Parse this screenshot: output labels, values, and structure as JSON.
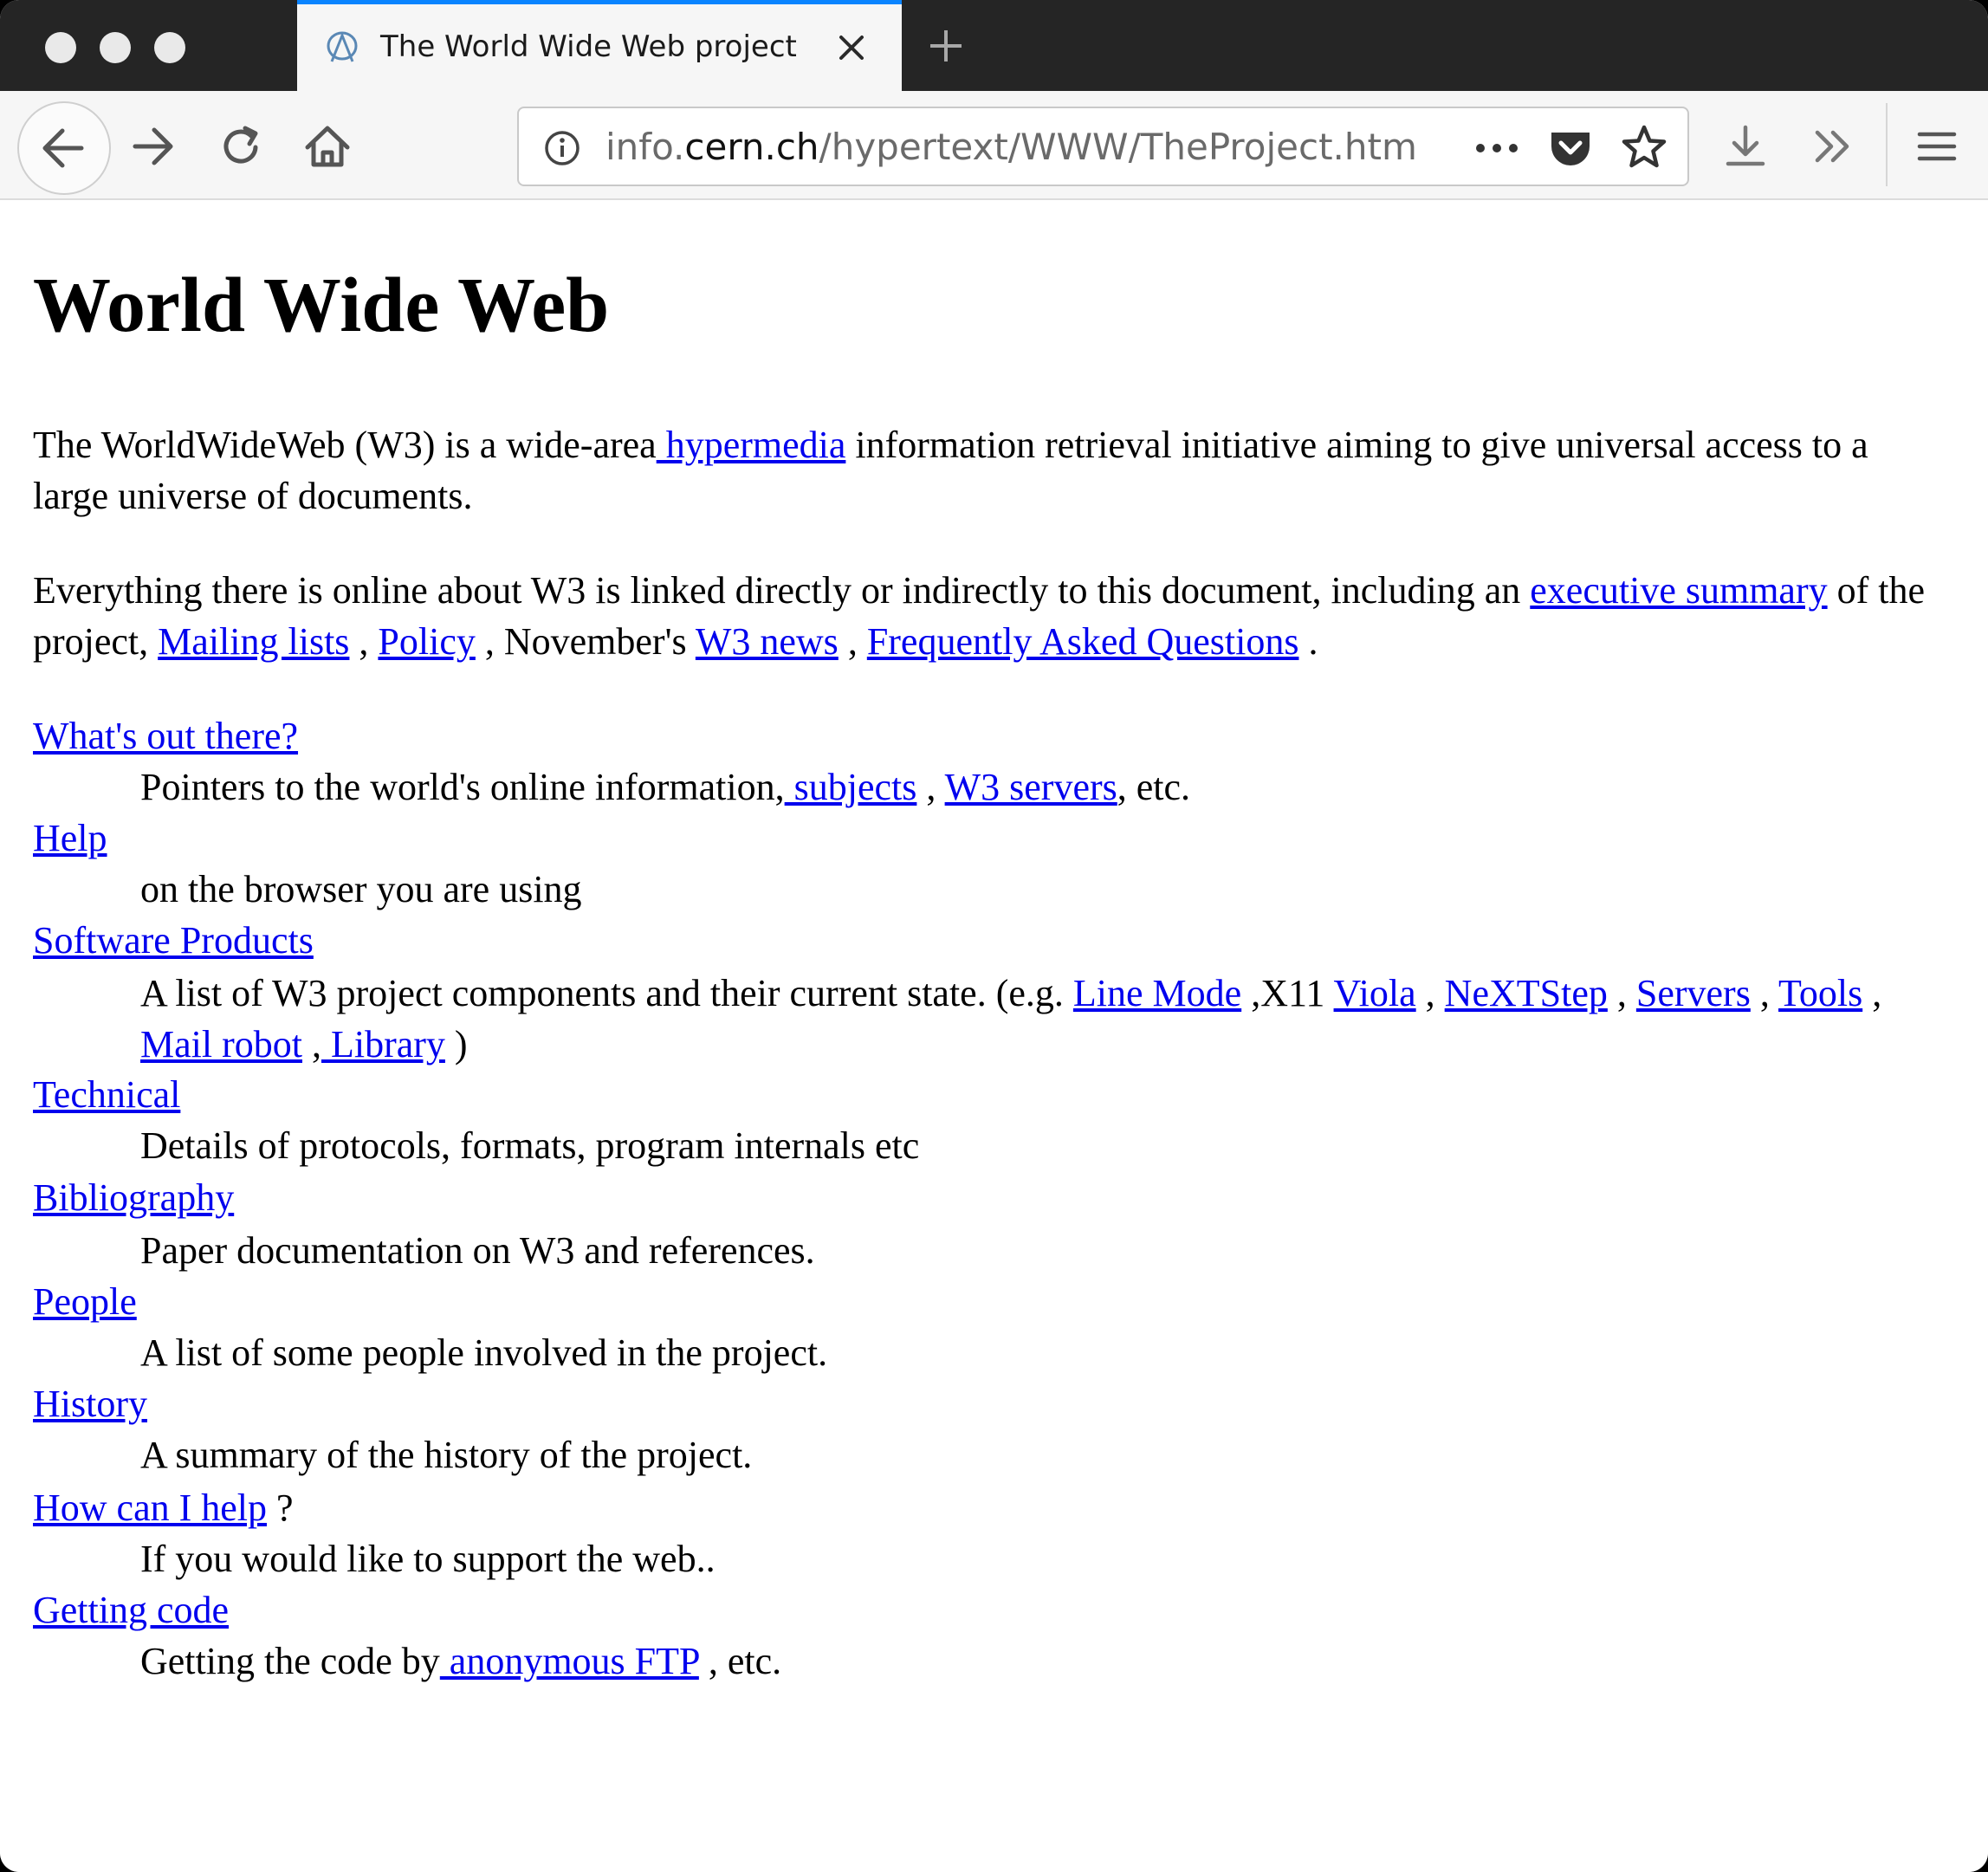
{
  "browser": {
    "tab_title": "The World Wide Web project",
    "url_prefix": "info.",
    "url_host": "cern.ch",
    "url_path": "/hypertext/WWW/TheProject.htm",
    "icons": {
      "back": "back-arrow-icon",
      "forward": "forward-arrow-icon",
      "reload": "reload-icon",
      "home": "home-icon",
      "info": "info-icon",
      "more": "ellipsis-icon",
      "pocket": "pocket-icon",
      "bookmark": "star-icon",
      "downloads": "download-icon",
      "overflow": "double-chevron-icon",
      "menu": "hamburger-menu-icon",
      "close_tab": "close-icon",
      "new_tab": "plus-icon"
    },
    "colors": {
      "titlebar": "#252525",
      "tab_accent": "#0a84ff",
      "link": "#0000ee"
    }
  },
  "page": {
    "heading": "World Wide Web",
    "intro": {
      "t1": "The WorldWideWeb (W3) is a wide-area",
      "link_hypermedia": " hypermedia",
      "t2": " information retrieval initiative aiming to give universal access to a large universe of documents."
    },
    "summary": {
      "t1": "Everything there is online about W3 is linked directly or indirectly to this document, including an ",
      "link_exec": "executive summary",
      "t2": " of the project, ",
      "link_mailing": "Mailing lists",
      "t3": " , ",
      "link_policy": "Policy",
      "t4": " , November's ",
      "link_news": "W3 news",
      "t5": " , ",
      "link_faq": "Frequently Asked Questions",
      "t6": " ."
    },
    "items": [
      {
        "term": "What's out there?",
        "desc_t1": "Pointers to the world's online information,",
        "desc_link1": " subjects",
        "desc_t2": " , ",
        "desc_link2": "W3 servers",
        "desc_t3": ", etc."
      },
      {
        "term": "Help",
        "desc": "on the browser you are using"
      },
      {
        "term": "Software Products",
        "desc_t1": "A list of W3 project components and their current state. (e.g. ",
        "link_linemode": "Line Mode",
        "t2": " ,X11 ",
        "link_viola": "Viola",
        "t3": " , ",
        "link_nextstep": "NeXTStep",
        "t4": " , ",
        "link_servers": "Servers",
        "t5": " , ",
        "link_tools": "Tools",
        "t6": " ,",
        "link_mailrobot": " Mail robot",
        "t7": " ,",
        "link_library": " Library",
        "t8": " )"
      },
      {
        "term": "Technical",
        "desc": "Details of protocols, formats, program internals etc"
      },
      {
        "term": "Bibliography",
        "desc": "Paper documentation on W3 and references."
      },
      {
        "term": "People",
        "desc": "A list of some people involved in the project."
      },
      {
        "term": "History",
        "desc": "A summary of the history of the project."
      },
      {
        "term": "How can I help",
        "term_suffix": " ?",
        "desc": "If you would like to support the web.."
      },
      {
        "term": "Getting code",
        "desc_t1": "Getting the code by",
        "desc_link1": " anonymous FTP",
        "desc_t2": " , etc."
      }
    ]
  }
}
